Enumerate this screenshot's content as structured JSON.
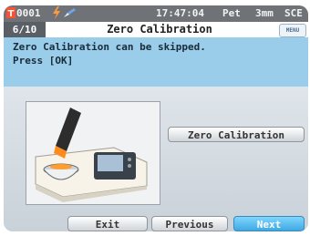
{
  "status_bar": {
    "id_text": "0001",
    "time": "17:47:04",
    "right_text": "Pet",
    "aperture": "3mm",
    "mode": "SCE"
  },
  "title_bar": {
    "step": "6/10",
    "title": "Zero Calibration",
    "menu_label": "MENU"
  },
  "message": {
    "line1": "Zero Calibration can be skipped.",
    "line2": "Press [OK]"
  },
  "actions": {
    "zero_calibration": "Zero Calibration",
    "exit": "Exit",
    "previous": "Previous",
    "next": "Next"
  },
  "colors": {
    "status_bar": "#6f7378",
    "message_bg": "#99cde9",
    "next_button": "#3fa8e2",
    "lightning": "#ff9a3c",
    "id_badge": "#ff4f2f"
  }
}
